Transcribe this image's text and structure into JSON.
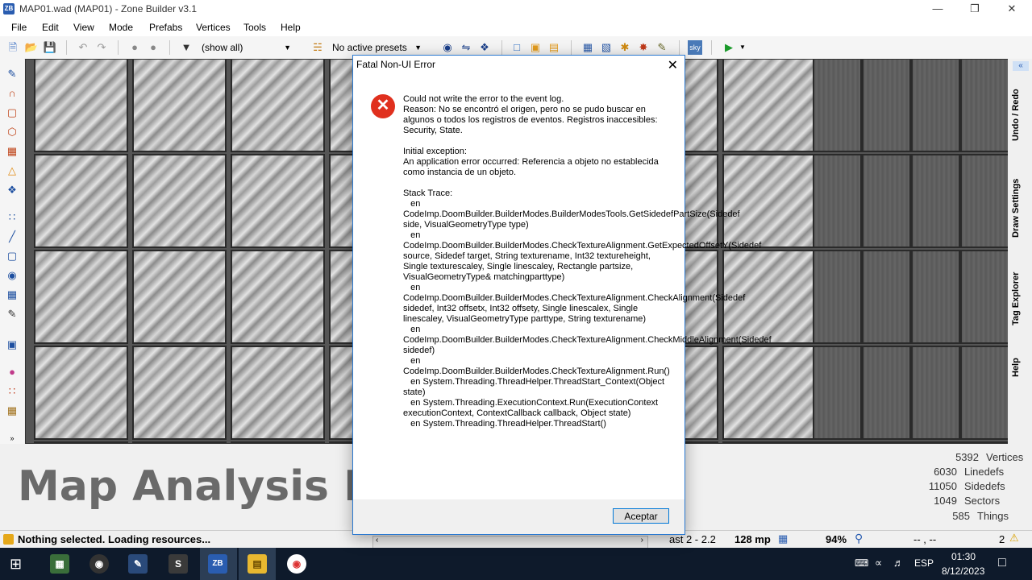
{
  "window": {
    "title": "MAP01.wad (MAP01) - Zone Builder v3.1",
    "app_badge": "ZB"
  },
  "menu": [
    "File",
    "Edit",
    "View",
    "Mode",
    "Prefabs",
    "Vertices",
    "Tools",
    "Help"
  ],
  "toolbar": {
    "filter_value": "(show all)",
    "presets_value": "No active presets"
  },
  "dock_tabs": [
    "Undo / Redo",
    "Draw Settings",
    "Tag Explorer",
    "Help"
  ],
  "info_panel": {
    "mode_title": "Map Analysis Mo",
    "stats": [
      {
        "value": "5392",
        "label": "Vertices"
      },
      {
        "value": "6030",
        "label": "Linedefs"
      },
      {
        "value": "11050",
        "label": "Sidedefs"
      },
      {
        "value": "1049",
        "label": "Sectors"
      },
      {
        "value": "585",
        "label": "Things"
      }
    ]
  },
  "statusbar": {
    "message": "Nothing selected. Loading resources...",
    "grid": "ast 2 - 2.2",
    "grid_size": "128 mp",
    "zoom": "94%",
    "coords": "-- , --",
    "warnings": "2"
  },
  "dialog": {
    "title": "Fatal Non-UI Error",
    "message": "Could not write the error to the event log.\nReason: No se encontró el origen, pero no se pudo buscar en algunos o todos los registros de eventos. Registros inaccesibles: Security, State.\n\nInitial exception:\nAn application error occurred: Referencia a objeto no establecida como instancia de un objeto.\n\nStack Trace:\n   en CodeImp.DoomBuilder.BuilderModes.BuilderModesTools.GetSidedefPartSize(Sidedef side, VisualGeometryType type)\n   en CodeImp.DoomBuilder.BuilderModes.CheckTextureAlignment.GetExpectedOffsetY(Sidedef source, Sidedef target, String texturename, Int32 textureheight, Single texturescaley, Single linescaley, Rectangle partsize, VisualGeometryType& matchingparttype)\n   en CodeImp.DoomBuilder.BuilderModes.CheckTextureAlignment.CheckAlignment(Sidedef sidedef, Int32 offsetx, Int32 offsety, Single linescalex, Single linescaley, VisualGeometryType parttype, String texturename)\n   en CodeImp.DoomBuilder.BuilderModes.CheckTextureAlignment.CheckMiddleAlignment(Sidedef sidedef)\n   en CodeImp.DoomBuilder.BuilderModes.CheckTextureAlignment.Run()\n   en System.Threading.ThreadHelper.ThreadStart_Context(Object state)\n   en System.Threading.ExecutionContext.Run(ExecutionContext executionContext, ContextCallback callback, Object state)\n   en System.Threading.ThreadHelper.ThreadStart()",
    "ok_label": "Aceptar"
  },
  "taskbar": {
    "language": "ESP",
    "time": "01:30",
    "date": "8/12/2023"
  }
}
